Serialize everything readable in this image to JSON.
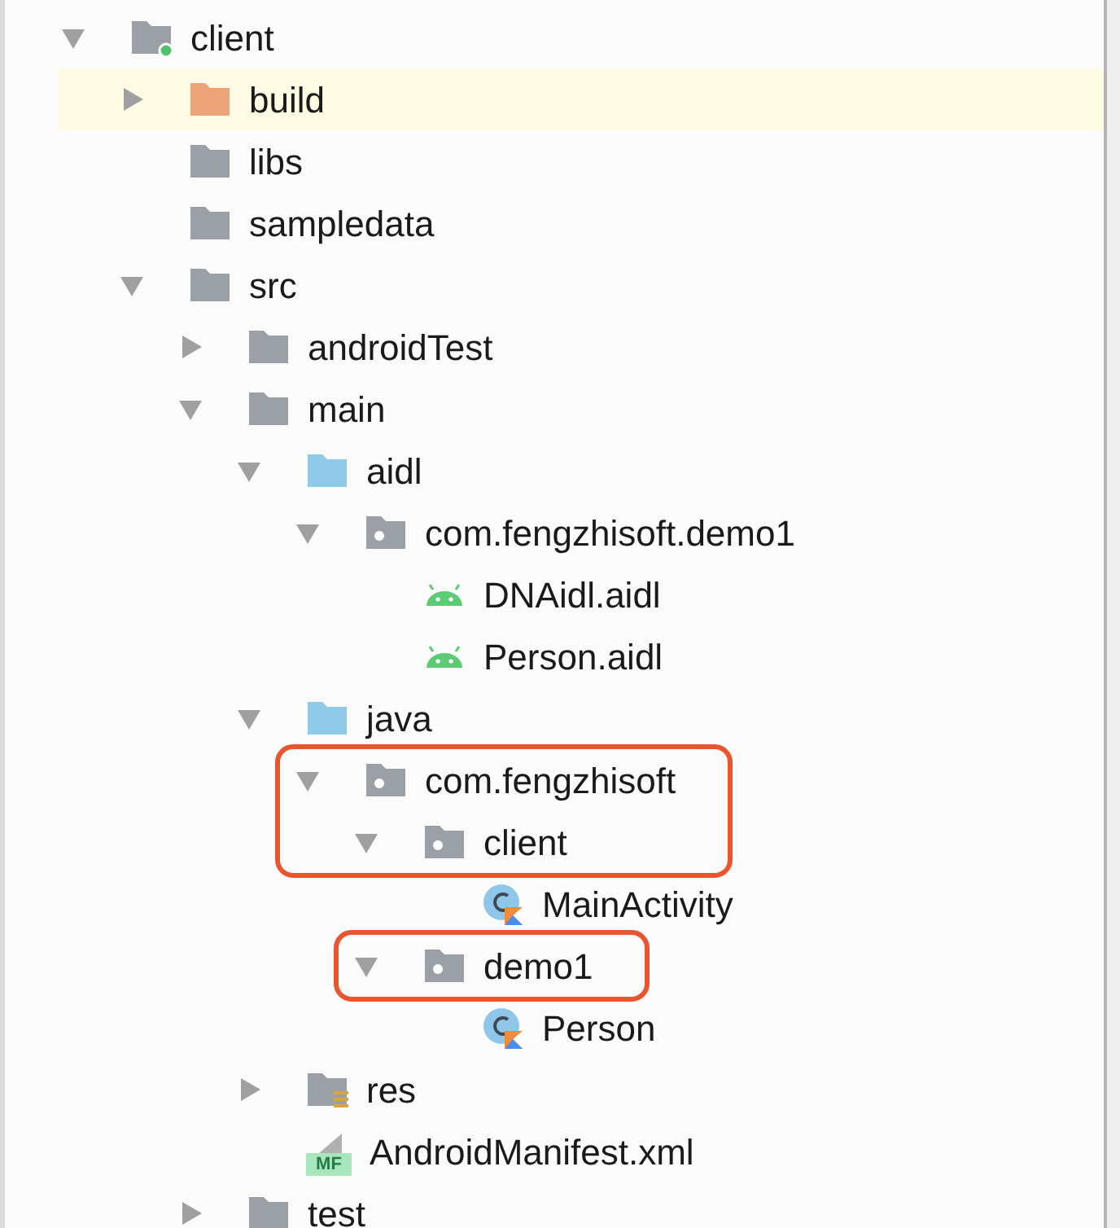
{
  "tree": [
    {
      "label": "client",
      "kind": "module",
      "expanded": true,
      "highlighted": false,
      "boxed": false,
      "children": [
        {
          "label": "build",
          "kind": "excluded",
          "expanded": false,
          "highlighted": true,
          "boxed": false
        },
        {
          "label": "libs",
          "kind": "folder",
          "highlighted": false,
          "boxed": false
        },
        {
          "label": "sampledata",
          "kind": "folder",
          "highlighted": false,
          "boxed": false
        },
        {
          "label": "src",
          "kind": "folder",
          "expanded": true,
          "highlighted": false,
          "boxed": false,
          "children": [
            {
              "label": "androidTest",
              "kind": "folder",
              "expanded": false,
              "highlighted": false,
              "boxed": false
            },
            {
              "label": "main",
              "kind": "folder",
              "expanded": true,
              "highlighted": false,
              "boxed": false,
              "children": [
                {
                  "label": "aidl",
                  "kind": "source",
                  "expanded": true,
                  "highlighted": false,
                  "boxed": false,
                  "children": [
                    {
                      "label": "com.fengzhisoft.demo1",
                      "kind": "package",
                      "expanded": true,
                      "highlighted": false,
                      "boxed": false,
                      "children": [
                        {
                          "label": "DNAidl.aidl",
                          "kind": "android",
                          "highlighted": false,
                          "boxed": false
                        },
                        {
                          "label": "Person.aidl",
                          "kind": "android",
                          "highlighted": false,
                          "boxed": false
                        }
                      ]
                    }
                  ]
                },
                {
                  "label": "java",
                  "kind": "source",
                  "expanded": true,
                  "highlighted": false,
                  "boxed": false,
                  "children": [
                    {
                      "label": "com.fengzhisoft",
                      "kind": "package",
                      "expanded": true,
                      "highlighted": false,
                      "boxed": true,
                      "children": [
                        {
                          "label": "client",
                          "kind": "package",
                          "expanded": true,
                          "highlighted": false,
                          "boxed": true,
                          "children": [
                            {
                              "label": "MainActivity",
                              "kind": "class",
                              "highlighted": false,
                              "boxed": false
                            }
                          ]
                        },
                        {
                          "label": "demo1",
                          "kind": "package",
                          "expanded": true,
                          "highlighted": false,
                          "boxed": true,
                          "children": [
                            {
                              "label": "Person",
                              "kind": "class",
                              "highlighted": false,
                              "boxed": false
                            }
                          ]
                        }
                      ]
                    }
                  ]
                },
                {
                  "label": "res",
                  "kind": "resources",
                  "expanded": false,
                  "highlighted": false,
                  "boxed": false
                },
                {
                  "label": "AndroidManifest.xml",
                  "kind": "manifest",
                  "badge": "MF",
                  "highlighted": false,
                  "boxed": false
                }
              ]
            },
            {
              "label": "test",
              "kind": "folder",
              "expanded": false,
              "highlighted": false,
              "boxed": false
            }
          ]
        }
      ]
    }
  ]
}
